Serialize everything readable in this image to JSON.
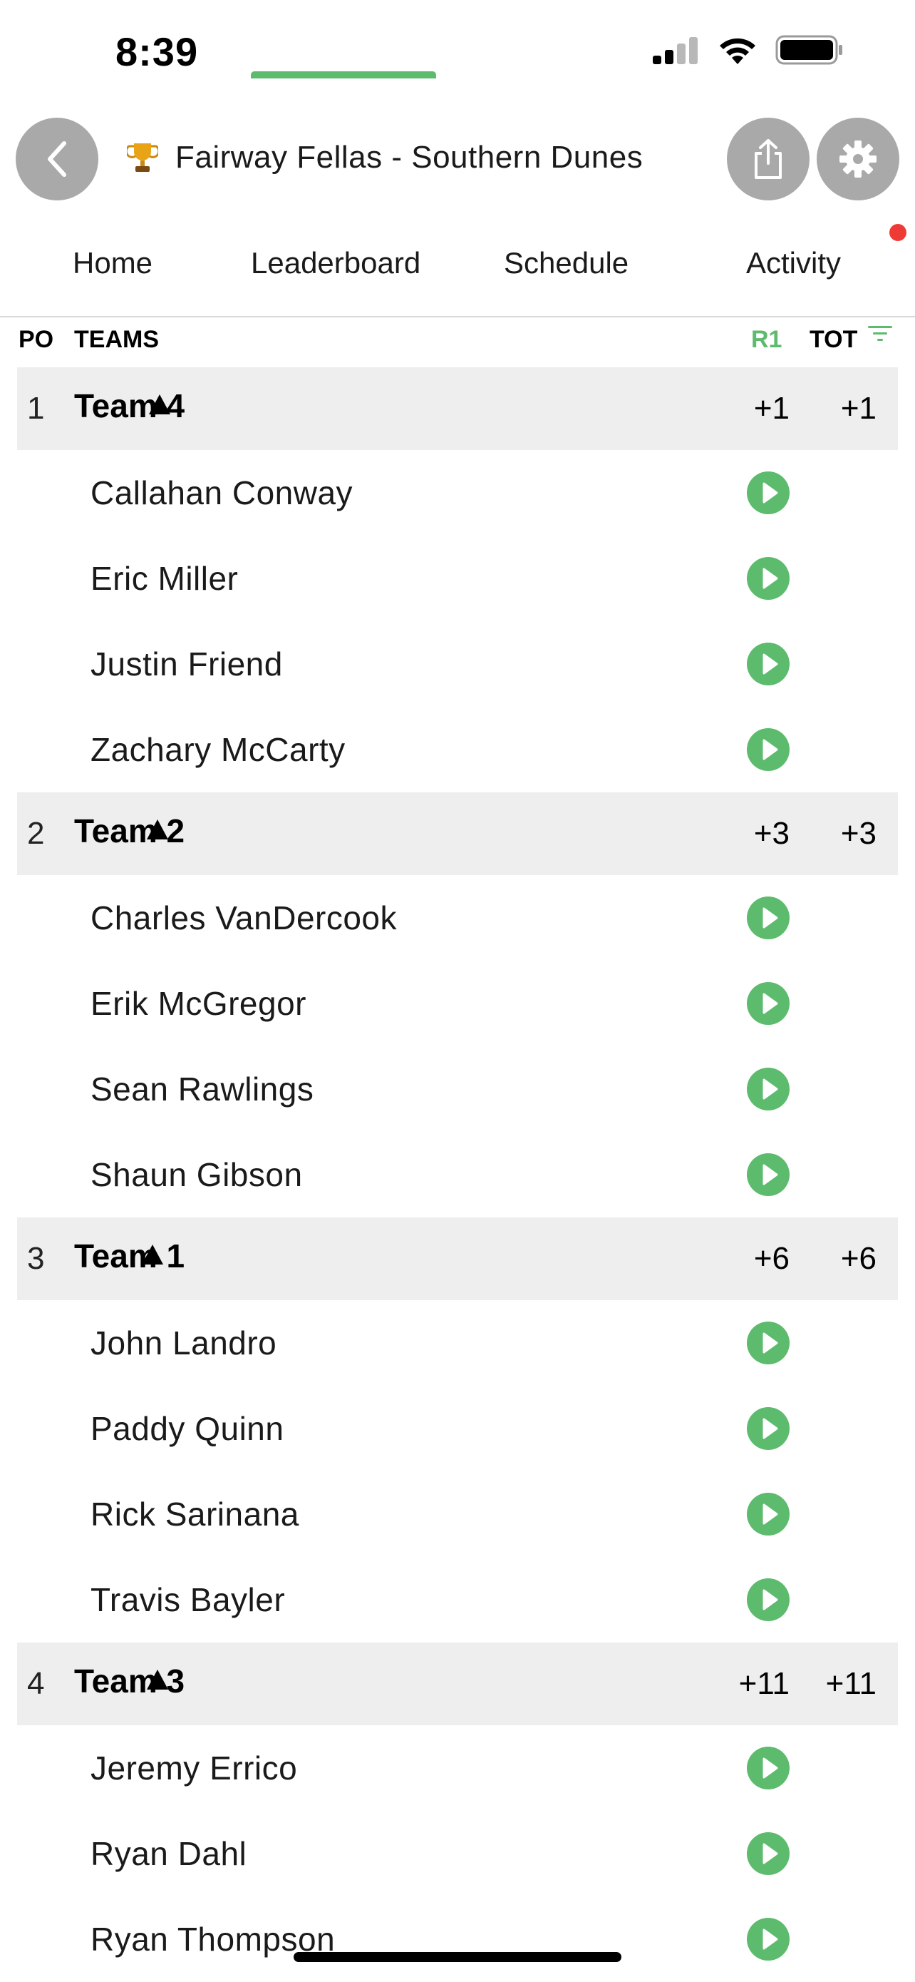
{
  "status_bar": {
    "time": "8:39"
  },
  "header": {
    "title": "Fairway Fellas - Southern Dunes"
  },
  "tabs": [
    {
      "label": "Home"
    },
    {
      "label": "Leaderboard"
    },
    {
      "label": "Schedule"
    },
    {
      "label": "Activity"
    }
  ],
  "active_tab": "Leaderboard",
  "columns": {
    "po": "PO",
    "teams": "TEAMS",
    "r1": "R1",
    "tot": "TOT"
  },
  "teams": [
    {
      "pos": "1",
      "name": "Team 4",
      "r1": "+1",
      "tot": "+1",
      "players": [
        "Callahan Conway",
        "Eric Miller",
        "Justin Friend",
        "Zachary McCarty"
      ]
    },
    {
      "pos": "2",
      "name": "Team 2",
      "r1": "+3",
      "tot": "+3",
      "players": [
        "Charles VanDercook",
        "Erik McGregor",
        "Sean Rawlings",
        "Shaun Gibson"
      ]
    },
    {
      "pos": "3",
      "name": "Team 1",
      "r1": "+6",
      "tot": "+6",
      "players": [
        "John Landro",
        "Paddy Quinn",
        "Rick Sarinana",
        "Travis Bayler"
      ]
    },
    {
      "pos": "4",
      "name": "Team 3",
      "r1": "+11",
      "tot": "+11",
      "players": [
        "Jeremy Errico",
        "Ryan Dahl",
        "Ryan Thompson"
      ]
    }
  ],
  "colors": {
    "accent": "#5dbb6e",
    "notification": "#ef3b36",
    "team_row_bg": "#eeeeee",
    "header_button": "#a9a9a9"
  },
  "icons": {
    "back": "chevron-left-icon",
    "trophy": "trophy-icon",
    "share": "share-icon",
    "settings": "gear-icon",
    "play": "play-icon",
    "filter": "filter-icon"
  }
}
